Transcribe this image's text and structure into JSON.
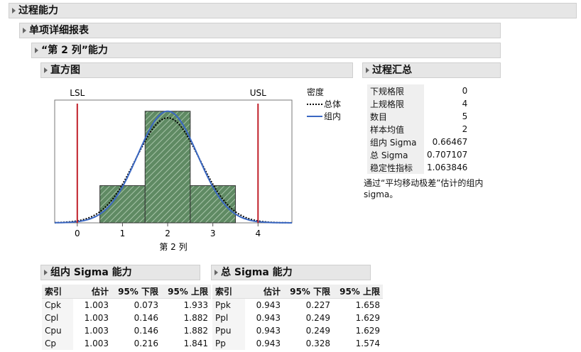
{
  "headers": {
    "h1": "过程能力",
    "h2": "单项详细报表",
    "h3": "“第 2 列”能力",
    "histogram": "直方图",
    "summary": "过程汇总",
    "within_cap": "组内 Sigma 能力",
    "overall_cap": "总 Sigma 能力"
  },
  "legend": {
    "title": "密度",
    "overall": "总体",
    "within": "组内"
  },
  "colors": {
    "spec_line": "#c0202a",
    "bar_fill": "#5f8a63",
    "within_curve": "#3a67c2",
    "overall_curve": "#000000"
  },
  "summary": [
    {
      "k": "下规格限",
      "v": "0"
    },
    {
      "k": "上规格限",
      "v": "4"
    },
    {
      "k": "数目",
      "v": "5"
    },
    {
      "k": "样本均值",
      "v": "2"
    },
    {
      "k": "组内 Sigma",
      "v": "0.66467"
    },
    {
      "k": "总 Sigma",
      "v": "0.707107"
    },
    {
      "k": "稳定性指标",
      "v": "1.063846"
    }
  ],
  "note": "通过“平均移动极差”估计的组内 sigma。",
  "within_table": {
    "columns": [
      "索引",
      "估计",
      "95% 下限",
      "95% 上限"
    ],
    "rows": [
      [
        "Cpk",
        "1.003",
        "0.073",
        "1.933"
      ],
      [
        "Cpl",
        "1.003",
        "0.146",
        "1.882"
      ],
      [
        "Cpu",
        "1.003",
        "0.146",
        "1.882"
      ],
      [
        "Cp",
        "1.003",
        "0.216",
        "1.841"
      ]
    ]
  },
  "overall_table": {
    "columns": [
      "索引",
      "估计",
      "95% 下限",
      "95% 上限"
    ],
    "rows": [
      [
        "Ppk",
        "0.943",
        "0.227",
        "1.658"
      ],
      [
        "Ppl",
        "0.943",
        "0.249",
        "1.629"
      ],
      [
        "Ppu",
        "0.943",
        "0.249",
        "1.629"
      ],
      [
        "Pp",
        "0.943",
        "0.328",
        "1.574"
      ]
    ]
  },
  "chart_data": {
    "type": "bar",
    "title": "",
    "xlabel": "第 2 列",
    "ylabel": "",
    "xlim": [
      -0.5,
      4.75
    ],
    "xticks": [
      0,
      1,
      2,
      3,
      4
    ],
    "bins": [
      {
        "start": 0.5,
        "end": 1.5,
        "count": 1
      },
      {
        "start": 1.5,
        "end": 2.5,
        "count": 3
      },
      {
        "start": 2.5,
        "end": 3.5,
        "count": 1
      }
    ],
    "ylim": [
      0,
      3.3
    ],
    "spec_limits": [
      {
        "name": "LSL",
        "value": 0
      },
      {
        "name": "USL",
        "value": 4
      }
    ],
    "mean": 2,
    "series": [
      {
        "name": "总体",
        "sigma": 0.707107,
        "style": "dotted"
      },
      {
        "name": "组内",
        "sigma": 0.66467,
        "style": "solid"
      }
    ]
  }
}
